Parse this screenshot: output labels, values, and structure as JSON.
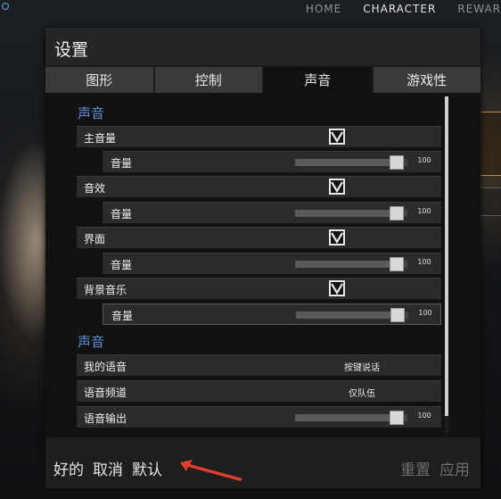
{
  "nav": {
    "items": [
      "HOME",
      "CHARACTER",
      "REWAR"
    ],
    "active_index": 1
  },
  "dialog": {
    "title": "设置",
    "tabs": [
      {
        "label": "图形",
        "active": false
      },
      {
        "label": "控制",
        "active": false
      },
      {
        "label": "声音",
        "active": true
      },
      {
        "label": "游戏性",
        "active": false
      }
    ],
    "sections": [
      {
        "title": "声音",
        "rows": [
          {
            "label": "主音量",
            "checked": true,
            "sub_label": "音量",
            "value": 100
          },
          {
            "label": "音效",
            "checked": true,
            "sub_label": "音量",
            "value": 100
          },
          {
            "label": "界面",
            "checked": true,
            "sub_label": "音量",
            "value": 100
          },
          {
            "label": "背景音乐",
            "checked": true,
            "sub_label": "音量",
            "value": 100
          }
        ]
      },
      {
        "title": "声音",
        "rows": [
          {
            "label": "我的语音",
            "value": "按键说话"
          },
          {
            "label": "语音频道",
            "value": "仅队伍"
          },
          {
            "label": "语音输出",
            "value": 100
          }
        ]
      }
    ],
    "footer": {
      "ok": "好的",
      "cancel": "取消",
      "default": "默认",
      "reset": "重置",
      "apply": "应用"
    },
    "colors": {
      "accent": "#5b8ed6",
      "annotation_arrow": "#e23c2e"
    }
  }
}
